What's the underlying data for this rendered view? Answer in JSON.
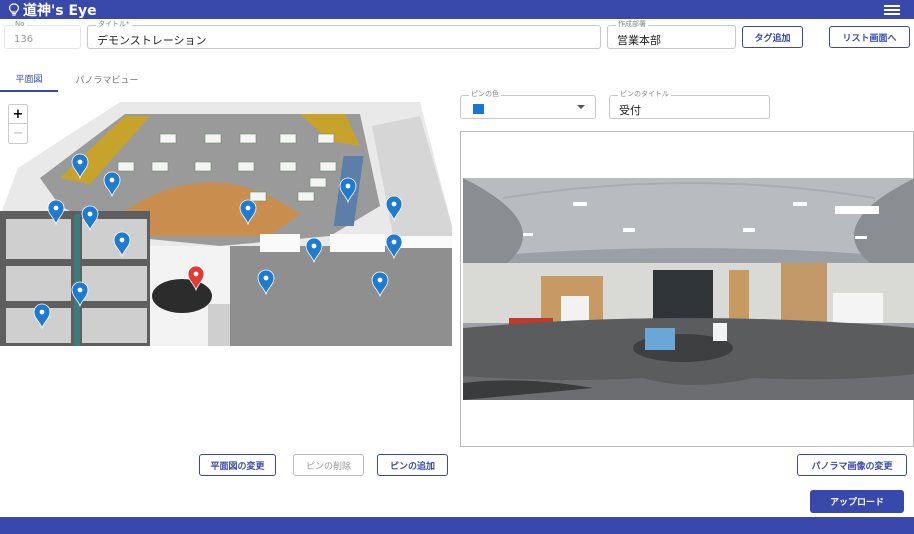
{
  "header": {
    "app_title": "道神's Eye"
  },
  "form": {
    "no_label": "No",
    "no_value": "136",
    "title_label": "タイトル*",
    "title_value": "デモンストレーション",
    "dept_label": "作成部署",
    "dept_value": "営業本部",
    "add_tag_button": "タグ追加",
    "list_button": "リスト画面へ"
  },
  "tabs": [
    {
      "label": "平面図",
      "active": true
    },
    {
      "label": "パノラマビュー",
      "active": false
    }
  ],
  "pin": {
    "color_label": "ピンの色",
    "color_value": "#1976d2",
    "title_label": "ピンのタイトル",
    "title_value": "受付"
  },
  "buttons": {
    "change_floor_plan": "平面図の変更",
    "delete_pin": "ピンの削除",
    "add_pin": "ピンの追加",
    "change_panorama": "パノラマ画像の変更",
    "upload": "アップロード"
  },
  "zoom": {
    "in": "+",
    "out": "−"
  },
  "colors": {
    "brand": "#3949ab",
    "pin_blue": "#1e7bd0",
    "pin_selected": "#e53935"
  },
  "pins": [
    {
      "id": "p1",
      "color": "blue"
    },
    {
      "id": "p2",
      "color": "blue"
    },
    {
      "id": "p3",
      "color": "blue"
    },
    {
      "id": "p4",
      "color": "blue"
    },
    {
      "id": "p5",
      "color": "blue"
    },
    {
      "id": "p6",
      "color": "blue"
    },
    {
      "id": "p7",
      "color": "blue"
    },
    {
      "id": "p8",
      "color": "blue"
    },
    {
      "id": "p9",
      "color": "blue"
    },
    {
      "id": "p10",
      "color": "blue"
    },
    {
      "id": "p11",
      "color": "blue"
    },
    {
      "id": "p12",
      "color": "blue"
    },
    {
      "id": "p13",
      "color": "blue"
    },
    {
      "id": "p14",
      "color": "blue"
    },
    {
      "id": "p15",
      "color": "red"
    }
  ]
}
